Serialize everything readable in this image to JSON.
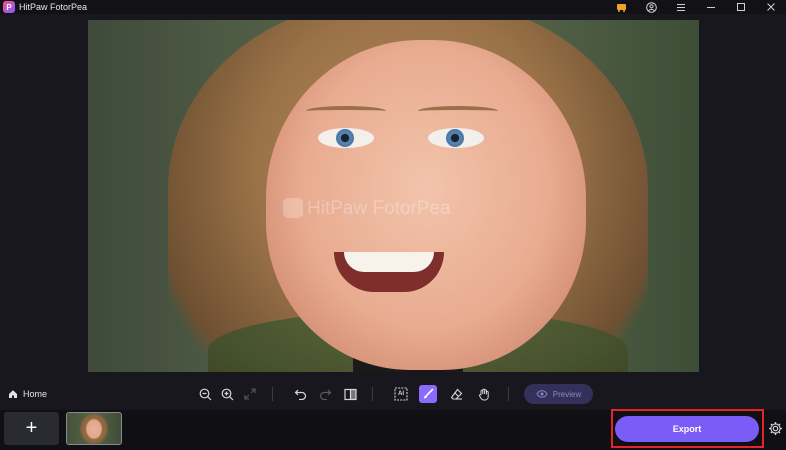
{
  "window": {
    "title": "HitPaw FotorPea",
    "logo_letter": "P"
  },
  "titlebar_icons": [
    "cart-icon",
    "account-icon",
    "more-icon",
    "minimize-icon",
    "maximize-icon",
    "close-icon"
  ],
  "canvas": {
    "watermark": "HitPaw FotorPea"
  },
  "toolbar": {
    "home_label": "Home",
    "tools": [
      "zoom-out-icon",
      "zoom-in-icon",
      "fit-screen-icon",
      "undo-icon",
      "redo-icon",
      "compare-icon",
      "ai-select-icon",
      "brush-icon",
      "eraser-icon",
      "hand-icon"
    ],
    "active_tool": "brush-icon",
    "ai_label": "AI",
    "preview_label": "Preview"
  },
  "bottombar": {
    "add_label": "+",
    "export_label": "Export"
  },
  "colors": {
    "accent": "#7b5cf6",
    "highlight": "#e3242b",
    "background": "#0f0f14"
  }
}
